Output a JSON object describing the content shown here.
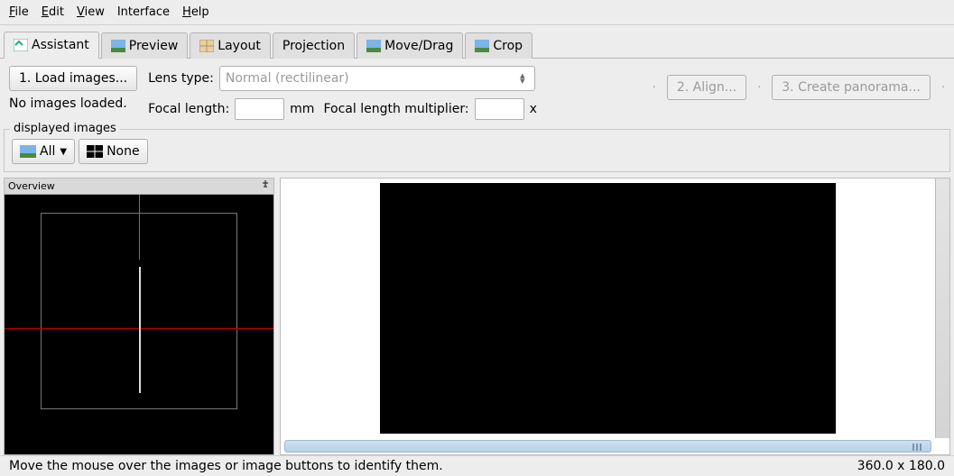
{
  "menu": {
    "file": "File",
    "edit": "Edit",
    "view": "View",
    "interface": "Interface",
    "help": "Help"
  },
  "tabs": {
    "assistant": "Assistant",
    "preview": "Preview",
    "layout": "Layout",
    "projection": "Projection",
    "movedrag": "Move/Drag",
    "crop": "Crop"
  },
  "assistant": {
    "load_images": "1. Load images...",
    "no_images": "No images loaded.",
    "lens_type_label": "Lens type:",
    "lens_type_value": "Normal (rectilinear)",
    "focal_length_label": "Focal length:",
    "focal_length_value": "",
    "mm": "mm",
    "focal_mult_label": "Focal length multiplier:",
    "focal_mult_value": "",
    "x": "x",
    "align": "2. Align...",
    "create_pano": "3. Create panorama..."
  },
  "displayed": {
    "group_label": "displayed images",
    "all": "All",
    "none": "None"
  },
  "overview": {
    "title": "Overview"
  },
  "status": {
    "hint": "Move the mouse over the images or image buttons to identify them.",
    "dims": "360.0 x 180.0"
  }
}
